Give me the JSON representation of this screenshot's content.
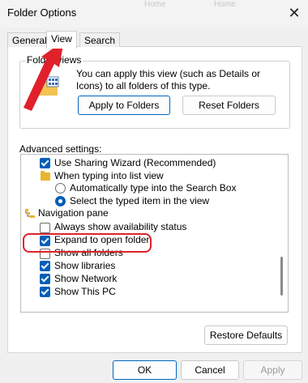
{
  "window": {
    "title": "Folder Options",
    "close_glyph": "✕",
    "background_text_1": "Home",
    "background_text_2": "Home"
  },
  "tabs": [
    {
      "label": "General",
      "active": false
    },
    {
      "label": "View",
      "active": true
    },
    {
      "label": "Search",
      "active": false
    }
  ],
  "folder_views": {
    "title": "Folder views",
    "description": "You can apply this view (such as Details or Icons) to all folders of this type.",
    "apply_button": "Apply to Folders",
    "reset_button": "Reset Folders",
    "icon": "folder-views-icon"
  },
  "advanced": {
    "label": "Advanced settings:",
    "items": [
      {
        "type": "checkbox",
        "checked": true,
        "label": "Use Sharing Wizard (Recommended)"
      },
      {
        "type": "folder",
        "label": "When typing into list view"
      },
      {
        "type": "radio",
        "checked": false,
        "label": "Automatically type into the Search Box"
      },
      {
        "type": "radio",
        "checked": true,
        "label": "Select the typed item in the view"
      },
      {
        "type": "nav",
        "label": "Navigation pane"
      },
      {
        "type": "checkbox",
        "checked": false,
        "label": "Always show availability status"
      },
      {
        "type": "checkbox",
        "checked": true,
        "label": "Expand to open folder"
      },
      {
        "type": "checkbox",
        "checked": false,
        "label": "Show all folders"
      },
      {
        "type": "checkbox",
        "checked": true,
        "label": "Show libraries"
      },
      {
        "type": "checkbox",
        "checked": true,
        "label": "Show Network"
      },
      {
        "type": "checkbox",
        "checked": true,
        "label": "Show This PC"
      }
    ],
    "restore_button": "Restore Defaults"
  },
  "footer": {
    "ok": "OK",
    "cancel": "Cancel",
    "apply": "Apply"
  },
  "colors": {
    "accent": "#005fb8",
    "highlight": "#e0212b",
    "folder": "#e8b530"
  }
}
